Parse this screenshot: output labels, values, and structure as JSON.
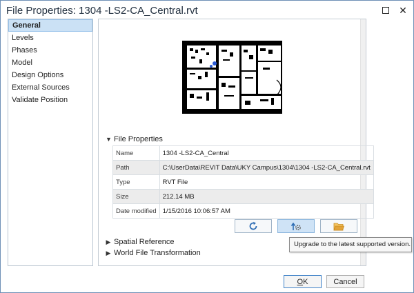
{
  "window": {
    "title": "File Properties: 1304 -LS2-CA_Central.rvt",
    "close_glyph": "✕"
  },
  "nav": {
    "items": [
      {
        "label": "General",
        "selected": true
      },
      {
        "label": "Levels"
      },
      {
        "label": "Phases"
      },
      {
        "label": "Model"
      },
      {
        "label": "Design Options"
      },
      {
        "label": "External Sources"
      },
      {
        "label": "Validate Position"
      }
    ]
  },
  "file_properties": {
    "header": "File Properties",
    "rows": [
      {
        "key": "Name",
        "value": "1304 -LS2-CA_Central"
      },
      {
        "key": "Path",
        "value": "C:\\UserData\\REVIT Data\\UKY Campus\\1304\\1304 -LS2-CA_Central.rvt"
      },
      {
        "key": "Type",
        "value": "RVT File"
      },
      {
        "key": "Size",
        "value": "212.14 MB"
      },
      {
        "key": "Date modified",
        "value": "1/15/2016 10:06:57 AM"
      }
    ]
  },
  "actions": {
    "refresh_icon": "refresh-icon",
    "upgrade_icon": "upgrade-icon",
    "open_folder_icon": "open-folder-icon"
  },
  "tooltip": {
    "text": "Upgrade to the latest supported version."
  },
  "sections": {
    "spatial_reference": "Spatial Reference",
    "world_file": "World File Transformation"
  },
  "buttons": {
    "ok": "OK",
    "cancel": "Cancel"
  },
  "colors": {
    "selection": "#cbe1f5",
    "accent": "#3c7fc7",
    "refresh": "#2e6db4",
    "folder": "#e2a33a"
  }
}
